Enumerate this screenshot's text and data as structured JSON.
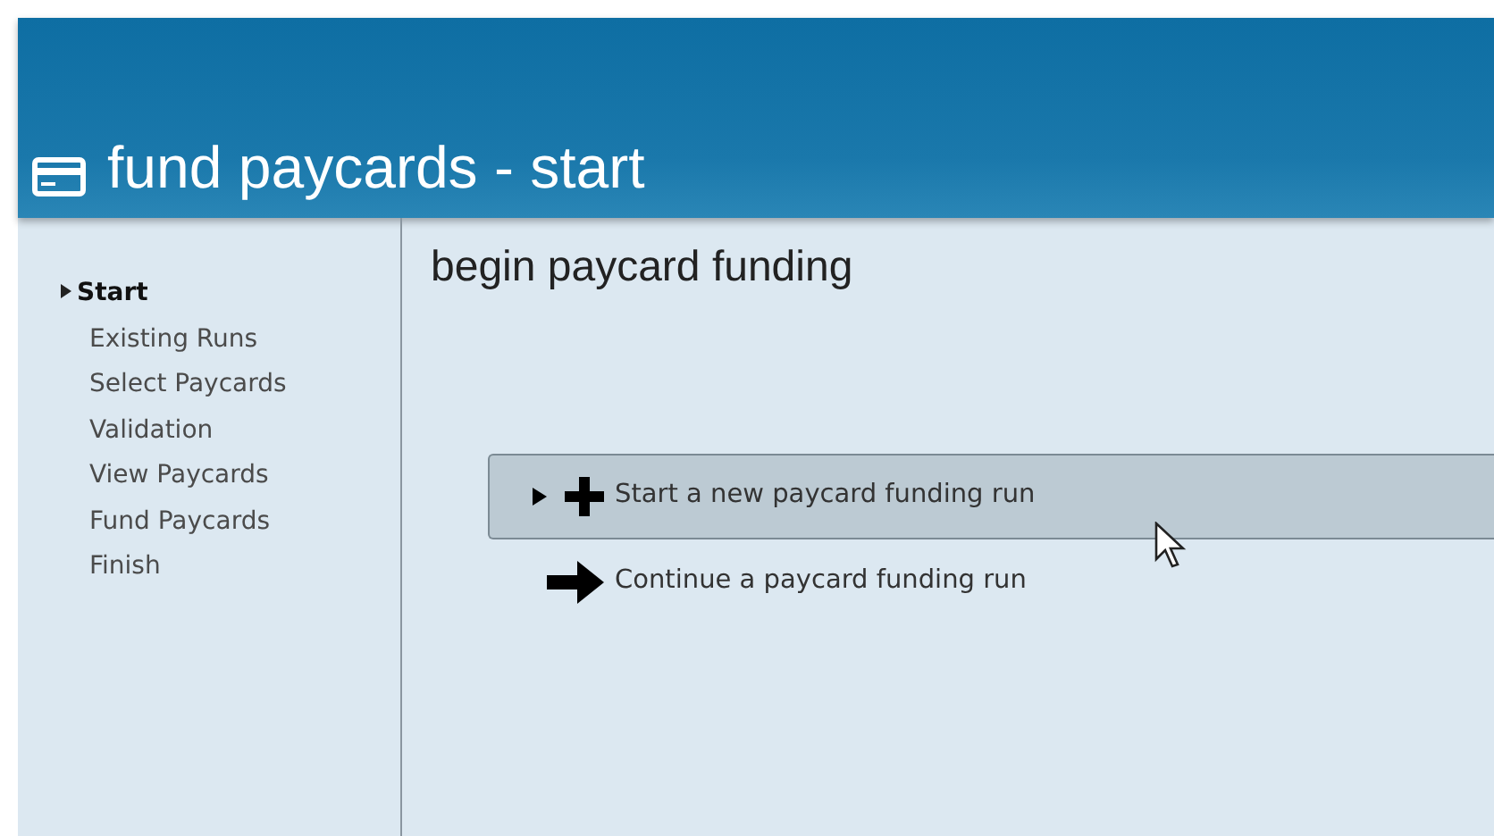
{
  "header": {
    "title": "fund paycards - start"
  },
  "sidebar": {
    "items": [
      {
        "label": "Start",
        "selected": true
      },
      {
        "label": "Existing Runs",
        "selected": false
      },
      {
        "label": "Select Paycards",
        "selected": false
      },
      {
        "label": "Validation",
        "selected": false
      },
      {
        "label": "View Paycards",
        "selected": false
      },
      {
        "label": "Fund Paycards",
        "selected": false
      },
      {
        "label": "Finish",
        "selected": false
      }
    ]
  },
  "content": {
    "heading": "begin paycard funding",
    "options": [
      {
        "kind": "new",
        "label": "Start a new paycard funding run",
        "selected": true
      },
      {
        "kind": "continue",
        "label": "Continue a paycard funding run",
        "selected": false
      }
    ]
  }
}
